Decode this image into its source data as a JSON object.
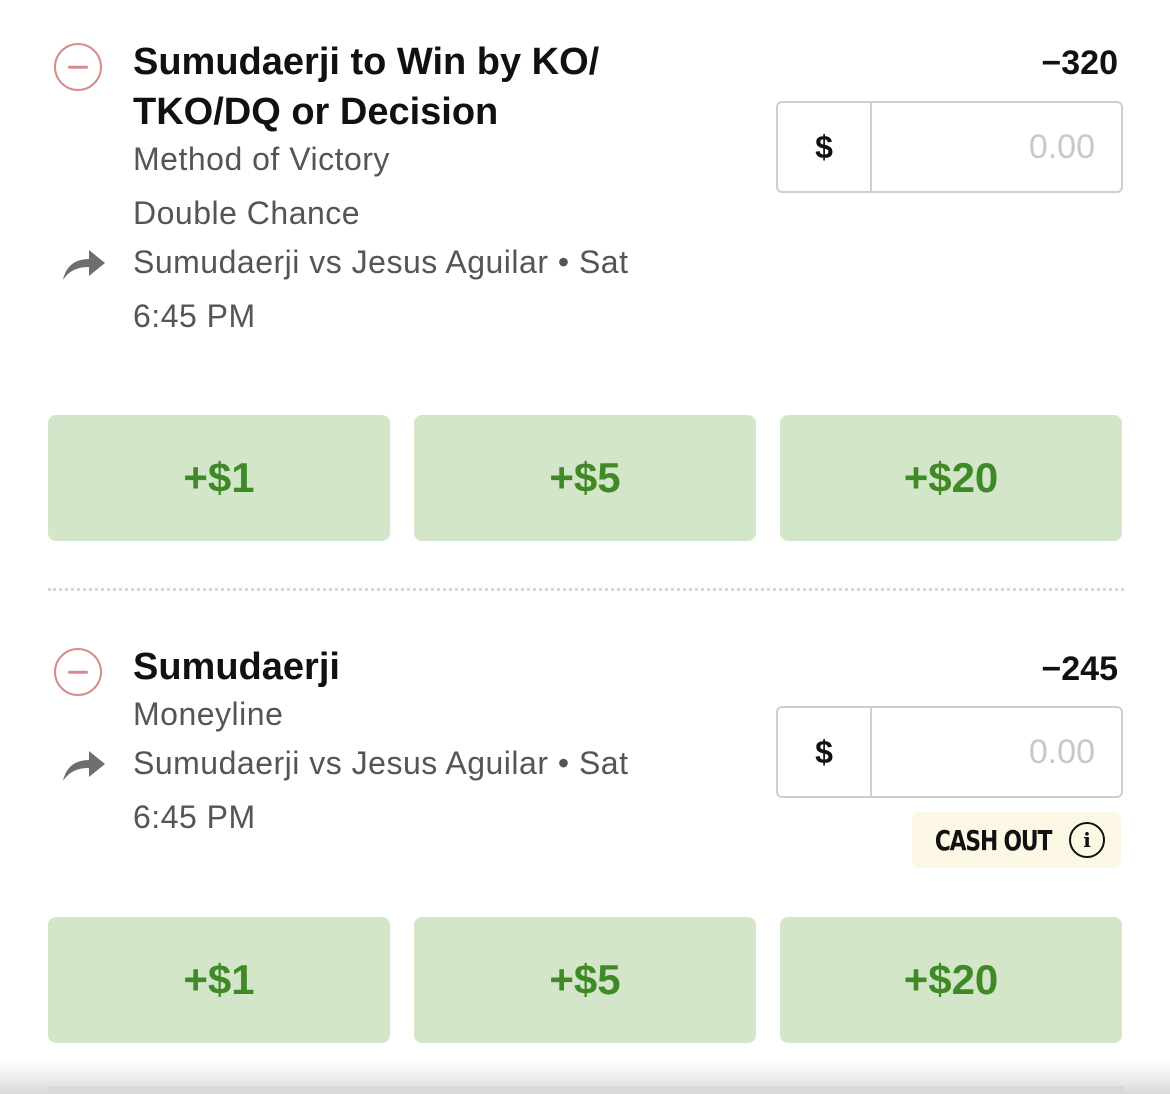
{
  "bets": [
    {
      "title_line1": "Sumudaerji to Win by KO/",
      "title_line2": "TKO/DQ or Decision",
      "market": "Method of Victory",
      "sub_market": "Double Chance",
      "event": "Sumudaerji vs Jesus Aguilar • Sat",
      "time": "6:45 PM",
      "odds": "−320",
      "currency": "$",
      "stake_placeholder": "0.00",
      "quick_adds": [
        "+$1",
        "+$5",
        "+$20"
      ],
      "icons": {
        "remove": "remove-circle-icon",
        "share": "share-arrow-icon"
      }
    },
    {
      "title_line1": "Sumudaerji",
      "market": "Moneyline",
      "event": "Sumudaerji vs Jesus Aguilar • Sat",
      "time": "6:45 PM",
      "odds": "−245",
      "currency": "$",
      "stake_placeholder": "0.00",
      "quick_adds": [
        "+$1",
        "+$5",
        "+$20"
      ],
      "cash_out_label": "CASH OUT",
      "icons": {
        "remove": "remove-circle-icon",
        "share": "share-arrow-icon",
        "info": "info-icon"
      }
    }
  ],
  "colors": {
    "quick_add_bg": "#d3e6c9",
    "quick_add_text": "#3f8a26",
    "remove_icon": "#d98a8e",
    "cash_out_bg": "#fdf8e6",
    "placeholder": "#c8c8c8"
  }
}
